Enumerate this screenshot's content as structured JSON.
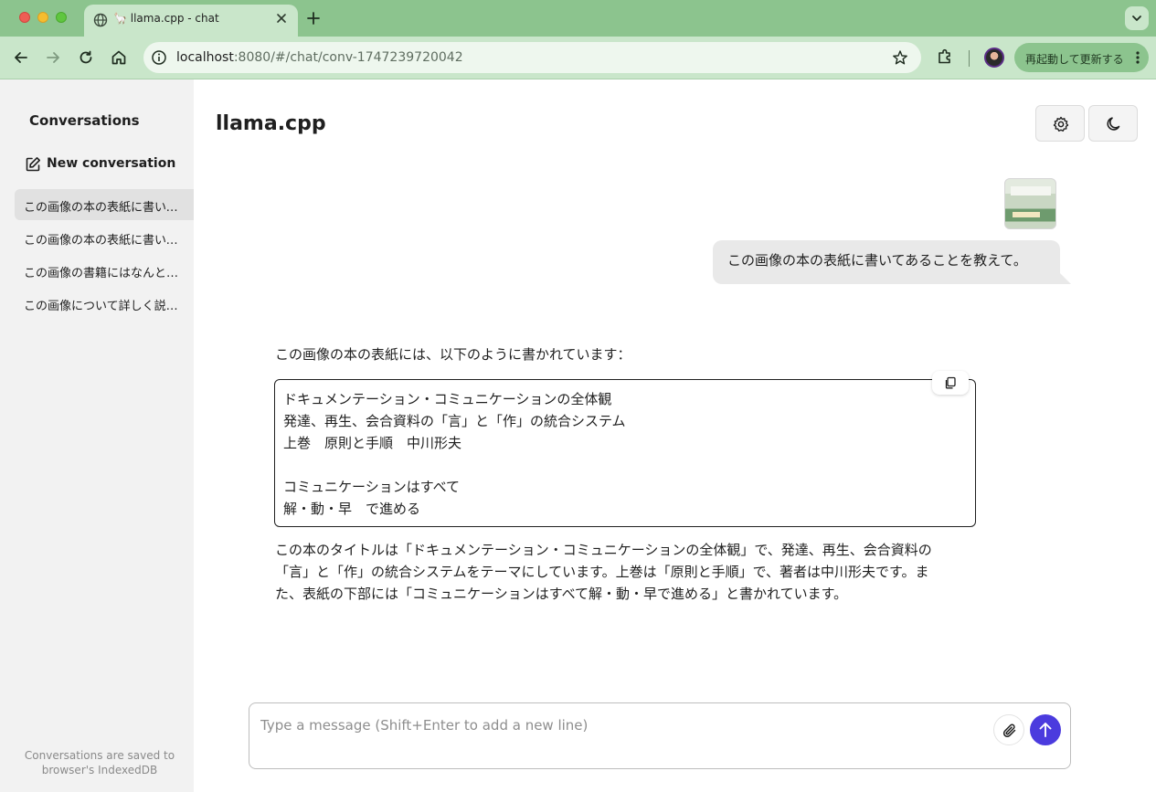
{
  "browser": {
    "tab_title": "🦙 llama.cpp - chat",
    "url_host": "localhost",
    "url_rest": ":8080/#/chat/conv-1747239720042",
    "update_button_label": "再起動して更新する",
    "icons": [
      "back-icon",
      "forward-icon",
      "reload-icon",
      "home-icon",
      "info-icon",
      "star-icon",
      "extensions-icon",
      "more-vert-icon",
      "globe-icon",
      "close-icon",
      "plus-icon",
      "chevron-down-icon"
    ]
  },
  "sidebar": {
    "title": "Conversations",
    "new_conversation_label": "New conversation",
    "conversations": [
      {
        "label": "この画像の本の表紙に書いてあることを教えて。",
        "active": true
      },
      {
        "label": "この画像の本の表紙に書いてあることを教えて。",
        "active": false
      },
      {
        "label": "この画像の書籍にはなんと書いてありますか？",
        "active": false
      },
      {
        "label": "この画像について詳しく説明してください。",
        "active": false
      }
    ],
    "footer_line1": "Conversations are saved to",
    "footer_line2": "browser's IndexedDB"
  },
  "header": {
    "title": "llama.cpp",
    "icons": [
      "settings-icon",
      "moon-icon"
    ]
  },
  "chat": {
    "user_message": "この画像の本の表紙に書いてあることを教えて。",
    "assistant_intro": "この画像の本の表紙には、以下のように書かれています：",
    "code_lines": [
      "ドキュメンテーション・コミュニケーションの全体観",
      "発達、再生、会合資料の「言」と「作」の統合システム",
      "上巻　原則と手順　中川形夫",
      "",
      "コミュニケーションはすべて",
      "解・動・早　で進める"
    ],
    "assistant_paragraph_lines": [
      "この本のタイトルは「ドキュメンテーション・コミュニケーションの全体観」で、発達、再生、会合資料の",
      "「言」と「作」の統合システムをテーマにしています。上巻は「原則と手順」で、著者は中川形夫です。ま",
      "た、表紙の下部には「コミュニケーションはすべて解・動・早で進める」と書かれています。"
    ]
  },
  "composer": {
    "placeholder": "Type a message (Shift+Enter to add a new line)",
    "value": ""
  },
  "colors": {
    "chrome_tabstrip": "#8cc48e",
    "chrome_toolbar": "#c9e6ca",
    "send_button": "#4b3bde",
    "sidebar_bg": "#f2f2f2",
    "user_bubble": "#e9e9e9"
  }
}
